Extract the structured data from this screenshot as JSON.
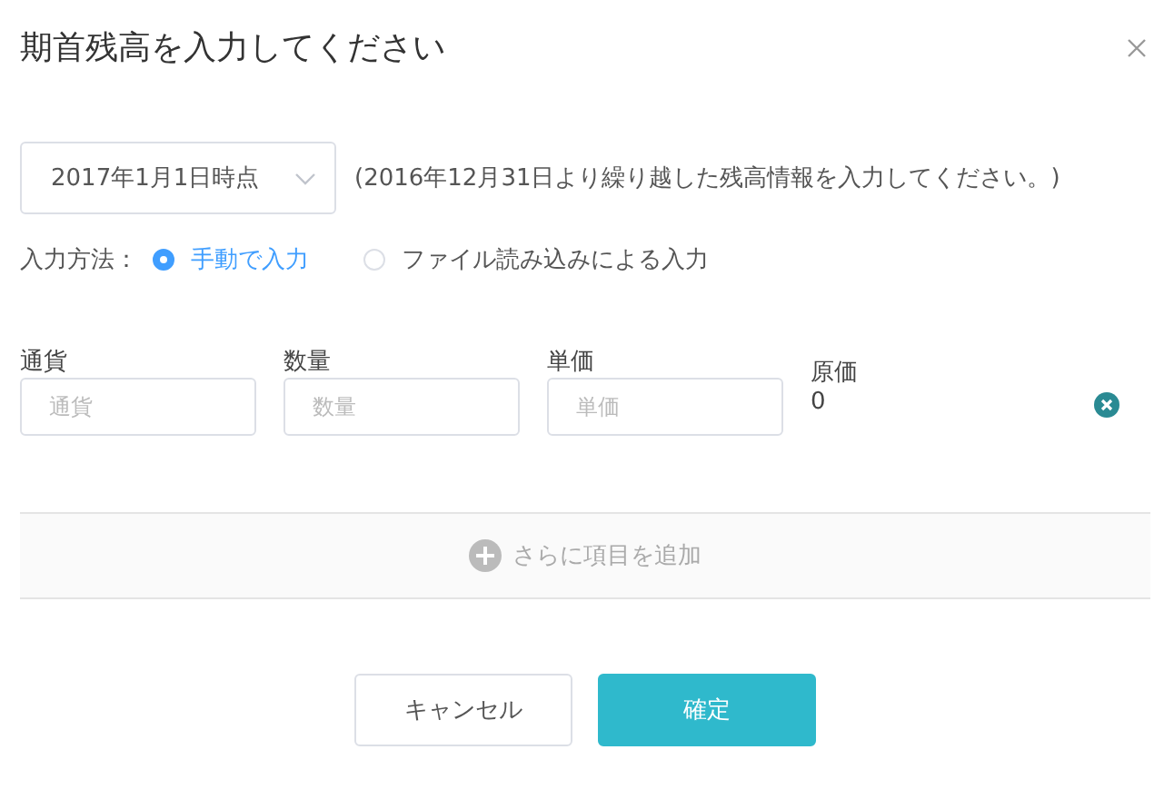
{
  "dialog": {
    "title": "期首残高を入力してください"
  },
  "date_select": {
    "value": "2017年1月1日時点"
  },
  "note": "(2016年12月31日より繰り越した残高情報を入力してください。)",
  "input_method": {
    "label": "入力方法：",
    "options": [
      {
        "label": "手動で入力",
        "selected": true
      },
      {
        "label": "ファイル読み込みによる入力",
        "selected": false
      }
    ]
  },
  "item_row": {
    "fields": [
      {
        "label": "通貨",
        "placeholder": "通貨"
      },
      {
        "label": "数量",
        "placeholder": "数量"
      },
      {
        "label": "単価",
        "placeholder": "単価"
      }
    ],
    "cost": {
      "label": "原価",
      "value": "0"
    }
  },
  "add_item": {
    "label": "さらに項目を追加"
  },
  "buttons": [
    {
      "label": "キャンセル",
      "kind": "secondary"
    },
    {
      "label": "確定",
      "kind": "primary"
    }
  ]
}
